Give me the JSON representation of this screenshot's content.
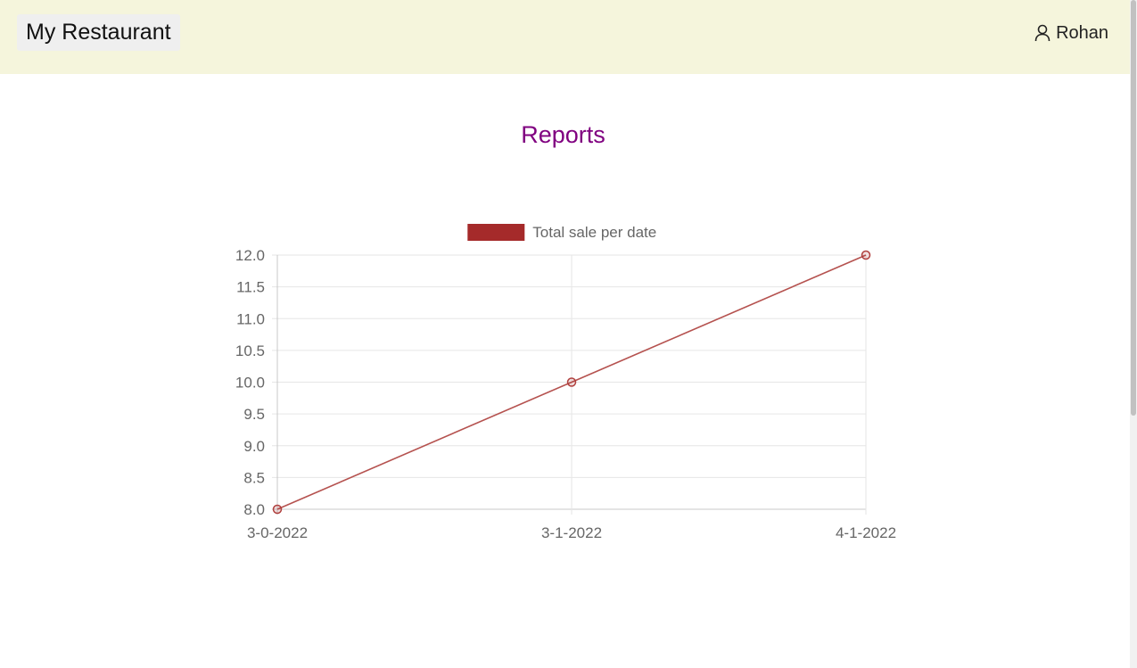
{
  "navbar": {
    "brand": "My Restaurant",
    "user_name": "Rohan",
    "background": "#f5f5dc"
  },
  "page": {
    "title": "Reports",
    "title_color": "#800080"
  },
  "chart_data": {
    "type": "line",
    "categories": [
      "3-0-2022",
      "3-1-2022",
      "4-1-2022"
    ],
    "series": [
      {
        "name": "Total sale per date",
        "values": [
          8.0,
          10.0,
          12.0
        ],
        "color": "#a52a2a"
      }
    ],
    "y_ticks": [
      "8.0",
      "8.5",
      "9.0",
      "9.5",
      "10.0",
      "10.5",
      "11.0",
      "11.5",
      "12.0"
    ],
    "ylim": [
      8.0,
      12.0
    ],
    "grid": true,
    "legend": "top"
  }
}
